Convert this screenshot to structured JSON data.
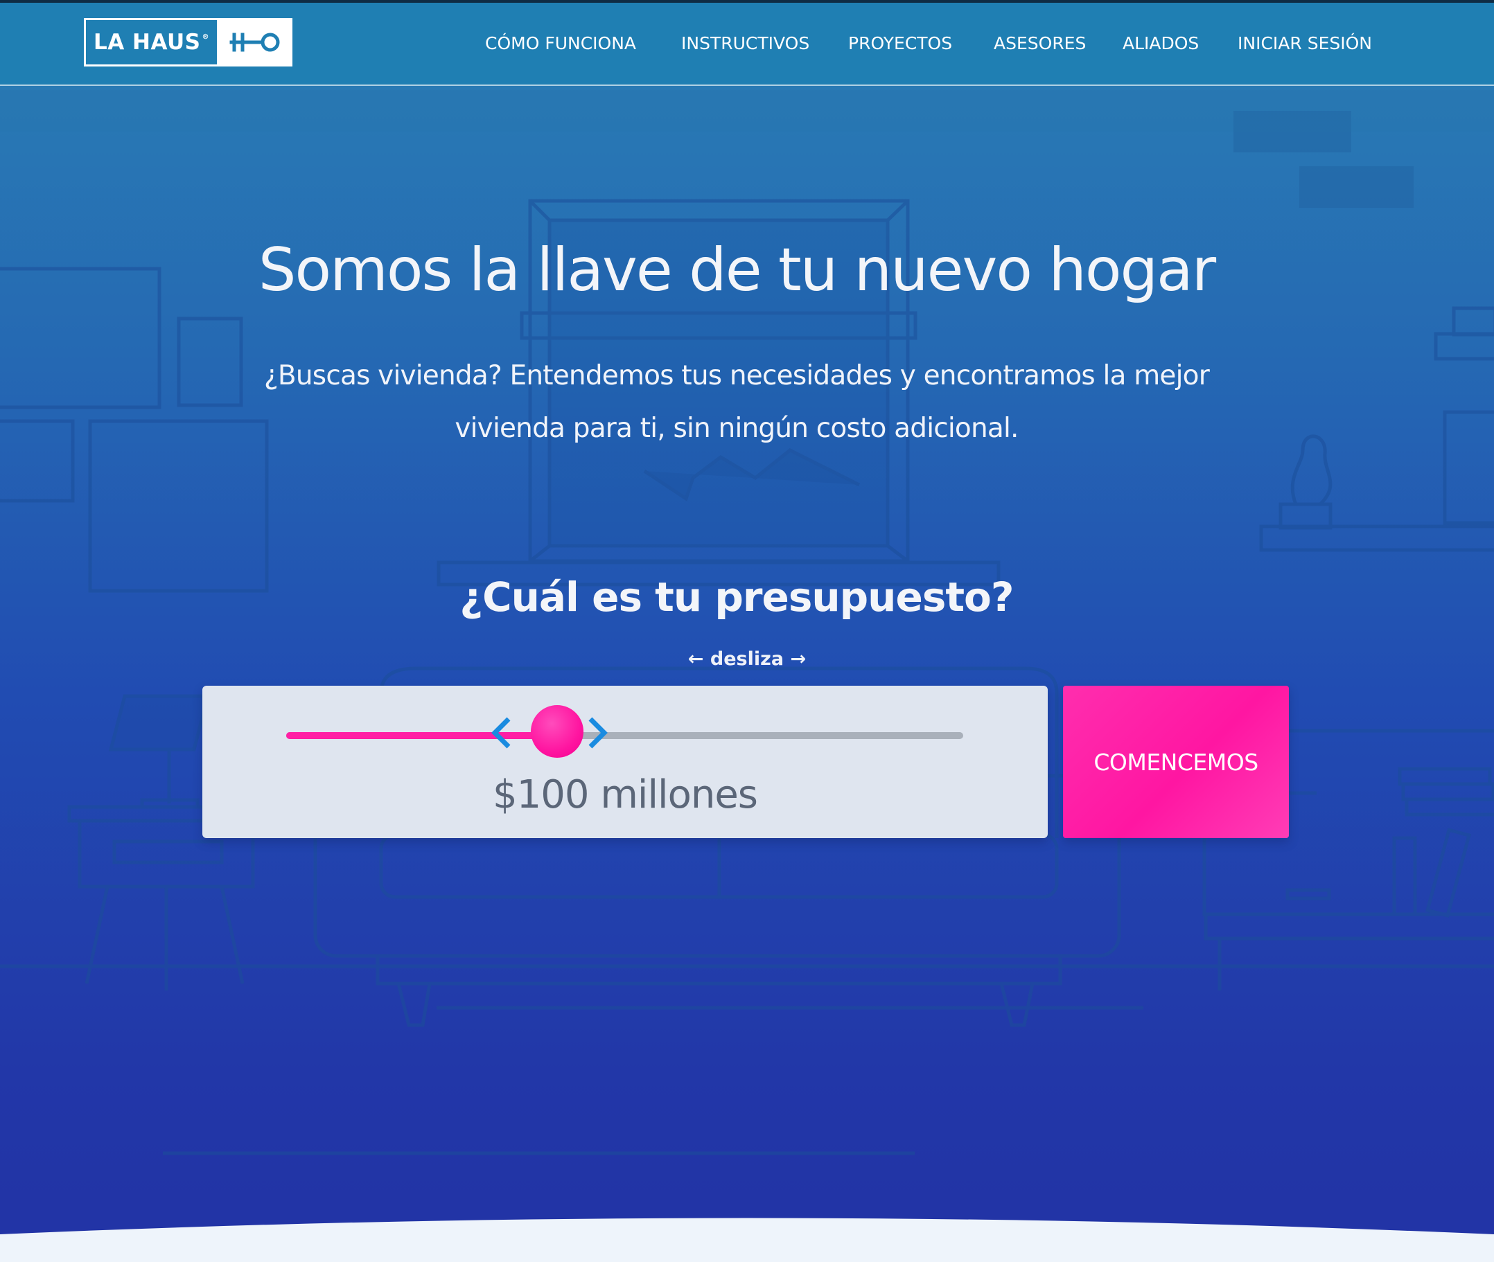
{
  "nav": {
    "logo_text": "LA HAUS",
    "links": [
      "CÓMO FUNCIONA",
      "INSTRUCTIVOS",
      "PROYECTOS",
      "ASESORES",
      "ALIADOS",
      "INICIAR SESIÓN"
    ]
  },
  "hero": {
    "headline": "Somos la llave de tu nuevo hogar",
    "subtitle": "¿Buscas vivienda? Entendemos tus necesidades y encontramos la mejor vivienda para ti, sin ningún costo adicional.",
    "question": "¿Cuál es tu presupuesto?",
    "hint": "← desliza →"
  },
  "budget": {
    "value_label": "$100 millones",
    "slider_fraction": 0.4,
    "cta_label": "COMENCEMOS"
  },
  "colors": {
    "nav_bg": "#1f7fb3",
    "accent_pink": "#ff1fa4",
    "card_bg": "#dfe5ef",
    "arrow_blue": "#1a8be0"
  },
  "icons": {
    "logo_key": "key-icon",
    "slider_left": "chevron-left-icon",
    "slider_right": "chevron-right-icon"
  }
}
